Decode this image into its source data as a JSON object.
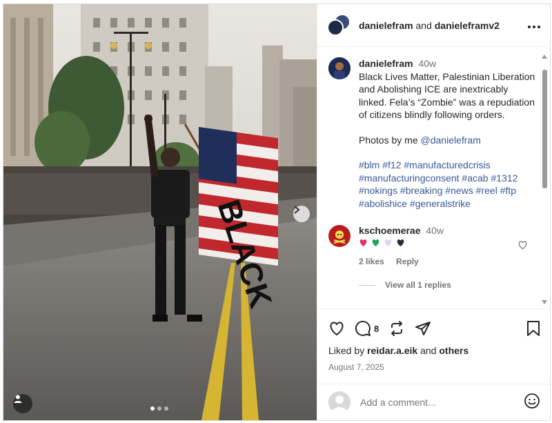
{
  "post": {
    "header": {
      "user1": "danielefram",
      "and": "and",
      "user2": "danielefram​v2"
    },
    "caption": {
      "username": "danielefram",
      "time": "40w",
      "text": "Black Lives Matter, Palestinian Liberation and Abolishing ICE are inextricably linked. Fela’s “Zombie” was a repudiation of citizens blindly following orders.",
      "photos_by": "Photos by me",
      "photos_by_handle": "@danielefram",
      "hashtags": "#blm #f12 #manufacturedcrisis #manufacturingconsent #acab #1312 #nokings #breaking #news #reel #ftp #abolishice #generalstrike"
    },
    "comment": {
      "username": "kschoemerae",
      "time": "40w",
      "hearts": [
        "#e1306c",
        "#22a559",
        "#e3d7ef",
        "#2b2b3a"
      ],
      "likes": "2 likes",
      "reply": "Reply",
      "view_replies": "View all 1 replies"
    },
    "actions": {
      "comment_count": "8",
      "liked_by_prefix": "Liked by",
      "liked_by_user": "reidar.a.eik",
      "liked_by_and": "and",
      "liked_by_others": "others",
      "date": "August 7, 2025"
    },
    "add_comment": {
      "placeholder": "Add a comment..."
    },
    "carousel": {
      "total": 3,
      "active": 1
    },
    "photo_subject": {
      "flag_text": "BLACK"
    }
  }
}
